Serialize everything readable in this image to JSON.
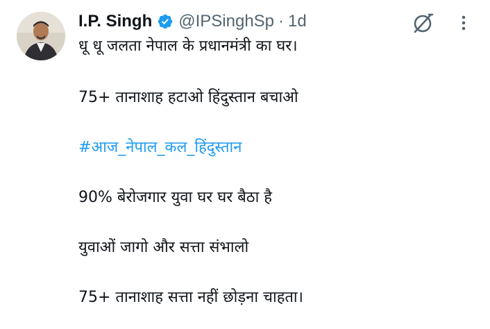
{
  "tweet": {
    "author_name": "I.P. Singh",
    "handle": "@IPSinghSp",
    "separator": "·",
    "timestamp": "1d",
    "verified": true,
    "lines": [
      "धू धू जलता नेपाल के प्रधानमंत्री का घर।",
      "75+ तानाशाह हटाओ हिंदुस्तान बचाओ",
      "#आज_नेपाल_कल_हिंदुस्तान",
      "90% बेरोजगार युवा घर घर बैठा है",
      "युवाओं जागो और सत्ता संभालो",
      "75+ तानाशाह सत्ता नहीं छोड़ना चाहता।"
    ]
  },
  "colors": {
    "verified_badge": "#1d9bf0",
    "hashtag": "#1d9bf0",
    "secondary_text": "#536471",
    "primary_text": "#0f1419"
  },
  "icons": {
    "verified": "verified-badge-icon",
    "grok": "grok-icon",
    "more": "more-vertical-icon"
  }
}
